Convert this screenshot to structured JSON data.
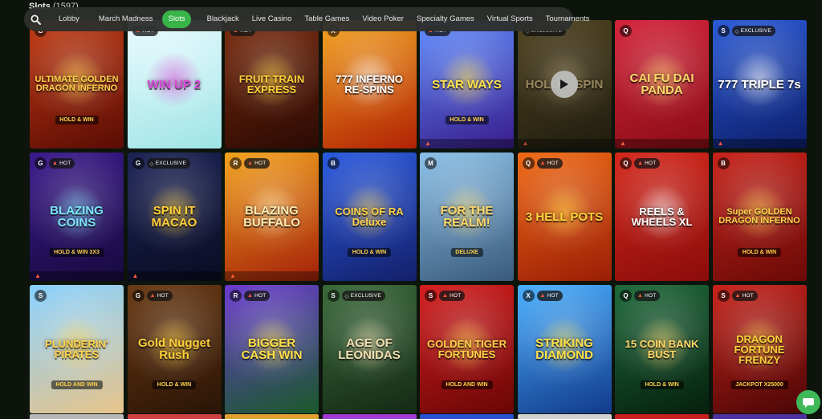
{
  "section": {
    "title": "Slots",
    "count": "(1597)"
  },
  "nav": {
    "items": [
      "Lobby",
      "March Madness",
      "Slots",
      "Blackjack",
      "Live Casino",
      "Table Games",
      "Video Poker",
      "Specialty Games",
      "Virtual Sports",
      "Tournaments"
    ],
    "active": "Slots"
  },
  "badges": {
    "hot": "HOT",
    "exclusive": "EXCLUSIVE"
  },
  "tiles": [
    {
      "name": "ULTIMATE GOLDEN DRAGON INFERNO",
      "sub": "HOLD & WIN",
      "bg1": "#c23a12",
      "bg2": "#5a0c05",
      "fg": "#ffd24a",
      "prov": "G",
      "badge": ""
    },
    {
      "name": "WIN UP 2",
      "sub": "",
      "bg1": "#e9fbff",
      "bg2": "#9fe4e6",
      "fg": "#d84ad8",
      "prov": "",
      "badge": "hot"
    },
    {
      "name": "FRUIT TRAIN EXPRESS",
      "sub": "",
      "bg1": "#7a2a0c",
      "bg2": "#2a0a04",
      "fg": "#ffcf3a",
      "prov": "",
      "badge": "hot"
    },
    {
      "name": "777 INFERNO RE-SPINS",
      "sub": "",
      "bg1": "#f2a21c",
      "bg2": "#b22306",
      "fg": "#ffffff",
      "prov": "X",
      "badge": ""
    },
    {
      "name": "STAR WAYS",
      "sub": "HOLD & WIN",
      "bg1": "#5d8cff",
      "bg2": "#3a1c8a",
      "fg": "#ffe14a",
      "prov": "",
      "badge": "hot"
    },
    {
      "name": "HOLD & SPIN",
      "sub": "",
      "bg1": "#6b5a2a",
      "bg2": "#2a2614",
      "fg": "#c9b47a",
      "prov": "",
      "badge": "exclusive"
    },
    {
      "name": "CAI FU DAI PANDA",
      "sub": "",
      "bg1": "#d4233a",
      "bg2": "#8a0d16",
      "fg": "#ffd86a",
      "prov": "Q",
      "badge": ""
    },
    {
      "name": "777 TRIPLE 7s",
      "sub": "",
      "bg1": "#2a5ad6",
      "bg2": "#0d1e6a",
      "fg": "#ffffff",
      "prov": "S",
      "badge": "exclusive"
    },
    {
      "name": "BLAZING COINS",
      "sub": "HOLD & WIN 3X3",
      "bg1": "#3a1a8c",
      "bg2": "#170a3e",
      "fg": "#7ee3ff",
      "prov": "G",
      "badge": "hot"
    },
    {
      "name": "SPIN IT MACAO",
      "sub": "",
      "bg1": "#1c2456",
      "bg2": "#0a0c22",
      "fg": "#ffcf3a",
      "prov": "G",
      "badge": "exclusive"
    },
    {
      "name": "BLAZING BUFFALO",
      "sub": "",
      "bg1": "#f2a21c",
      "bg2": "#a4200a",
      "fg": "#ffe9b0",
      "prov": "R",
      "badge": "hot"
    },
    {
      "name": "COINS OF RA Deluxe",
      "sub": "HOLD & WIN",
      "bg1": "#2a5ae0",
      "bg2": "#14206a",
      "fg": "#ffd24a",
      "prov": "B",
      "badge": ""
    },
    {
      "name": "FOR THE REALM!",
      "sub": "DELUXE",
      "bg1": "#8ac0e8",
      "bg2": "#3a5a7a",
      "fg": "#ffd86a",
      "prov": "M",
      "badge": ""
    },
    {
      "name": "3 HELL POTS",
      "sub": "",
      "bg1": "#f06a14",
      "bg2": "#9a1e06",
      "fg": "#ffcf3a",
      "prov": "Q",
      "badge": "hot"
    },
    {
      "name": "REELS & WHEELS XL",
      "sub": "",
      "bg1": "#d6281c",
      "bg2": "#8a0c0a",
      "fg": "#ffffff",
      "prov": "Q",
      "badge": "hot"
    },
    {
      "name": "Super GOLDEN DRAGON INFERNO",
      "sub": "HOLD & WIN",
      "bg1": "#c8231a",
      "bg2": "#6a0a08",
      "fg": "#ffd24a",
      "prov": "B",
      "badge": ""
    },
    {
      "name": "PLUNDERIN' PIRATES",
      "sub": "HOLD AND WIN",
      "bg1": "#86d0ff",
      "bg2": "#e8c48a",
      "fg": "#ffd24a",
      "prov": "S",
      "badge": ""
    },
    {
      "name": "Gold Nugget Rush",
      "sub": "HOLD & WIN",
      "bg1": "#6a3a14",
      "bg2": "#2a1406",
      "fg": "#ffcf3a",
      "prov": "G",
      "badge": "hot"
    },
    {
      "name": "BIGGER CASH WIN",
      "sub": "",
      "bg1": "#6a3ad0",
      "bg2": "#1a5a2a",
      "fg": "#ffe14a",
      "prov": "R",
      "badge": "hot"
    },
    {
      "name": "AGE OF LEONIDAS",
      "sub": "",
      "bg1": "#3a6a3a",
      "bg2": "#142a14",
      "fg": "#f0e0b0",
      "prov": "S",
      "badge": "exclusive"
    },
    {
      "name": "GOLDEN TIGER FORTUNES",
      "sub": "HOLD AND WIN",
      "bg1": "#d41e1e",
      "bg2": "#6a0606",
      "fg": "#ffd24a",
      "prov": "S",
      "badge": "hot"
    },
    {
      "name": "STRIKING DIAMOND",
      "sub": "",
      "bg1": "#4ab0ff",
      "bg2": "#123a8a",
      "fg": "#ffe14a",
      "prov": "X",
      "badge": "hot"
    },
    {
      "name": "15 COIN BANK BUST",
      "sub": "HOLD & WIN",
      "bg1": "#1e6a3a",
      "bg2": "#06200e",
      "fg": "#ffd86a",
      "prov": "Q",
      "badge": "hot"
    },
    {
      "name": "DRAGON FORTUNE FRENZY",
      "sub": "JACKPOT X25000",
      "bg1": "#c8231a",
      "bg2": "#4a0606",
      "fg": "#ffcf3a",
      "prov": "S",
      "badge": "hot"
    }
  ],
  "row4_colors": [
    "#b8b8b8",
    "#d04040",
    "#e0a030",
    "#a03ad0",
    "#2a50d0",
    "#d0d0d0",
    "#c82020",
    "#5030a0"
  ]
}
